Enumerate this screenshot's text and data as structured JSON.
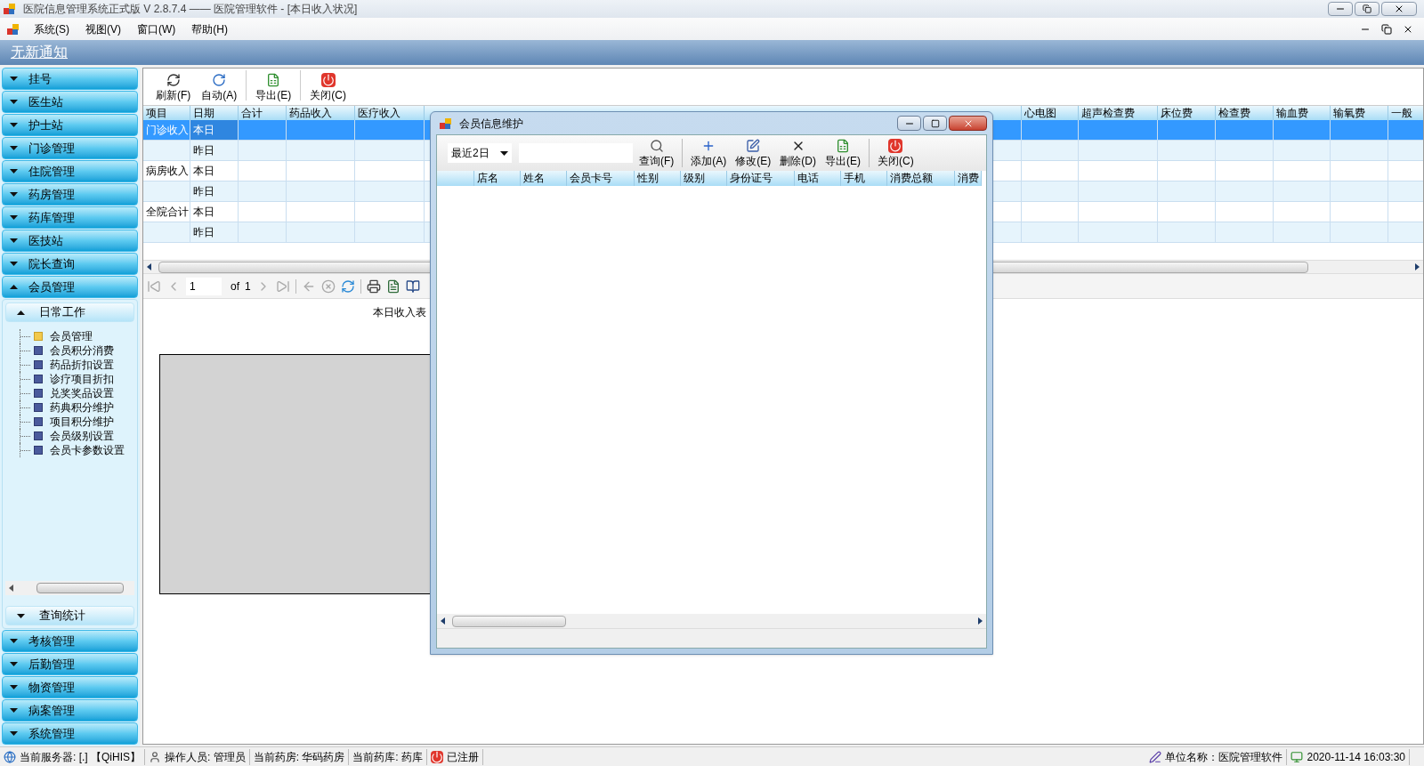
{
  "window": {
    "title": "医院信息管理系统正式版 V 2.8.7.4 —— 医院管理软件 - [本日收入状况]"
  },
  "menu": [
    "系统(S)",
    "视图(V)",
    "窗口(W)",
    "帮助(H)"
  ],
  "notice": "无新通知",
  "sidebar": {
    "items": [
      {
        "label": "挂号",
        "expanded": false
      },
      {
        "label": "医生站",
        "expanded": false
      },
      {
        "label": "护士站",
        "expanded": false
      },
      {
        "label": "门诊管理",
        "expanded": false
      },
      {
        "label": "住院管理",
        "expanded": false
      },
      {
        "label": "药房管理",
        "expanded": false
      },
      {
        "label": "药库管理",
        "expanded": false
      },
      {
        "label": "医技站",
        "expanded": false
      },
      {
        "label": "院长查询",
        "expanded": false
      },
      {
        "label": "会员管理",
        "expanded": true,
        "groups": [
          {
            "label": "日常工作",
            "expanded": true,
            "children": [
              {
                "label": "会员管理",
                "selected": true
              },
              {
                "label": "会员积分消费",
                "selected": false
              },
              {
                "label": "药品折扣设置",
                "selected": false
              },
              {
                "label": "诊疗项目折扣",
                "selected": false
              },
              {
                "label": "兑奖奖品设置",
                "selected": false
              },
              {
                "label": "药典积分维护",
                "selected": false
              },
              {
                "label": "项目积分维护",
                "selected": false
              },
              {
                "label": "会员级别设置",
                "selected": false
              },
              {
                "label": "会员卡参数设置",
                "selected": false
              }
            ]
          },
          {
            "label": "查询统计",
            "expanded": false
          }
        ]
      },
      {
        "label": "考核管理",
        "expanded": false
      },
      {
        "label": "后勤管理",
        "expanded": false
      },
      {
        "label": "物资管理",
        "expanded": false
      },
      {
        "label": "病案管理",
        "expanded": false
      },
      {
        "label": "系统管理",
        "expanded": false
      }
    ]
  },
  "toolbar": {
    "buttons": [
      {
        "label": "刷新(F)",
        "kind": "refresh"
      },
      {
        "label": "自动(A)",
        "kind": "auto"
      },
      {
        "label": "导出(E)",
        "kind": "export"
      },
      {
        "label": "关闭(C)",
        "kind": "close"
      }
    ]
  },
  "income_grid": {
    "columns": [
      "项目",
      "日期",
      "合计",
      "药品收入",
      "医疗收入"
    ],
    "right_columns": [
      "心电图",
      "超声检查费",
      "床位费",
      "检查费",
      "输血费",
      "输氧费",
      "一般"
    ],
    "rows": [
      {
        "item": "门诊收入",
        "date": "本日",
        "selected": true
      },
      {
        "date": "昨日",
        "selected": false
      },
      {
        "item": "病房收入",
        "date": "本日",
        "selected": false
      },
      {
        "date": "昨日",
        "selected": false
      },
      {
        "item": "全院合计",
        "date": "本日",
        "selected": false
      },
      {
        "date": "昨日",
        "selected": false
      }
    ]
  },
  "report": {
    "page": "1",
    "of": "of",
    "total": "1",
    "title": "本日收入表"
  },
  "dialog": {
    "title": "会员信息维护",
    "range": "最近2日",
    "buttons": [
      {
        "label": "查询(F)",
        "kind": "search"
      },
      {
        "label": "添加(A)",
        "kind": "add"
      },
      {
        "label": "修改(E)",
        "kind": "edit"
      },
      {
        "label": "删除(D)",
        "kind": "delete"
      },
      {
        "label": "导出(E)",
        "kind": "export"
      },
      {
        "label": "关闭(C)",
        "kind": "close"
      }
    ],
    "columns": [
      "店名",
      "姓名",
      "会员卡号",
      "性别",
      "级别",
      "身份证号",
      "电话",
      "手机",
      "消费总额",
      "消费"
    ]
  },
  "status_bar": {
    "left": [
      {
        "label": "当前服务器: [.] 【QiHIS】",
        "kind": "server"
      },
      {
        "label": "操作人员: 管理员",
        "kind": "user"
      },
      {
        "label": "当前药房: 华码药房",
        "kind": "text"
      },
      {
        "label": "当前药库: 药库",
        "kind": "text"
      },
      {
        "label": "已注册",
        "kind": "registered"
      }
    ],
    "right": [
      {
        "label": "单位名称：医院管理软件",
        "kind": "unit"
      },
      {
        "label": "2020-11-14 16:03:30",
        "kind": "clock"
      }
    ]
  }
}
